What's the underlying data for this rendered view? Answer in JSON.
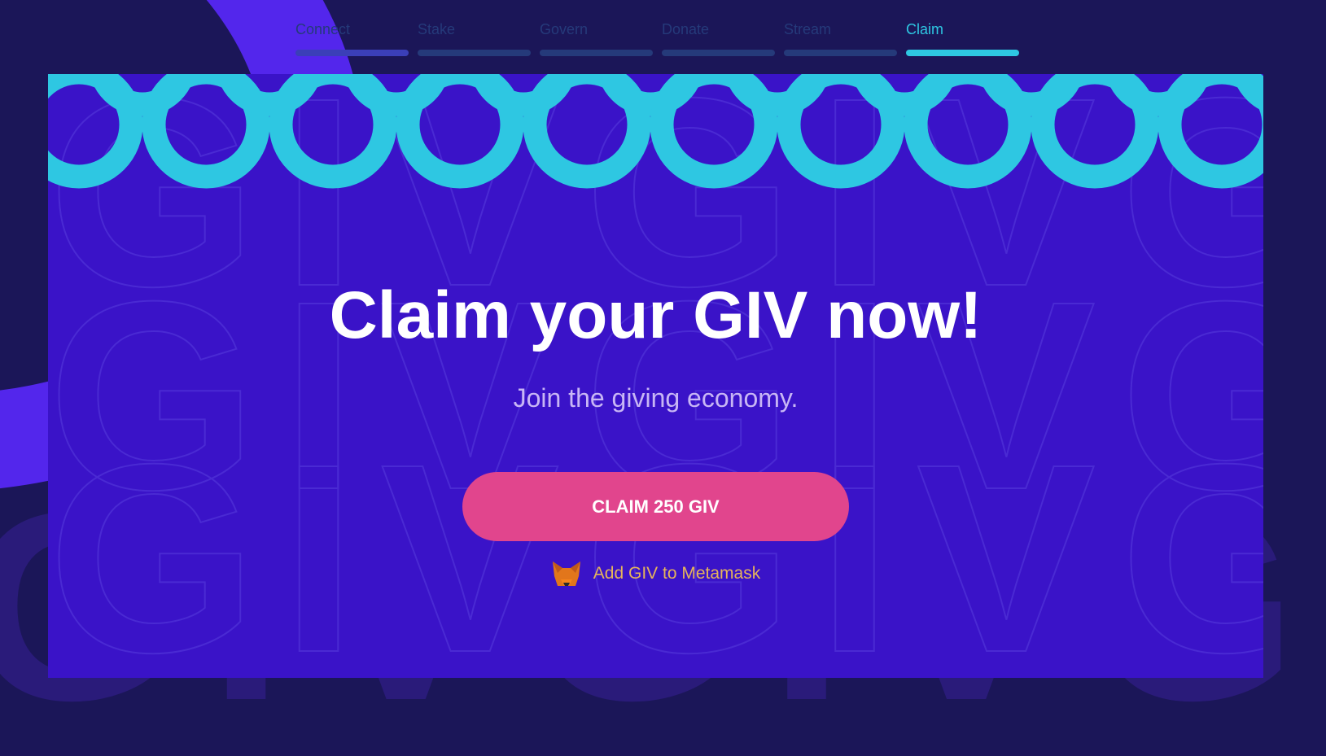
{
  "steps": [
    {
      "label": "Connect"
    },
    {
      "label": "Stake"
    },
    {
      "label": "Govern"
    },
    {
      "label": "Donate"
    },
    {
      "label": "Stream"
    },
    {
      "label": "Claim"
    }
  ],
  "active_step": "Claim",
  "hero": {
    "title": "Claim your GIV now!",
    "subtitle": "Join the giving economy.",
    "claim_button": "CLAIM 250 GIV",
    "metamask_link": "Add GIV to Metamask"
  },
  "colors": {
    "background": "#1b1658",
    "card": "#3a13c8",
    "accent": "#2ec7e2",
    "button": "#e1458d"
  }
}
